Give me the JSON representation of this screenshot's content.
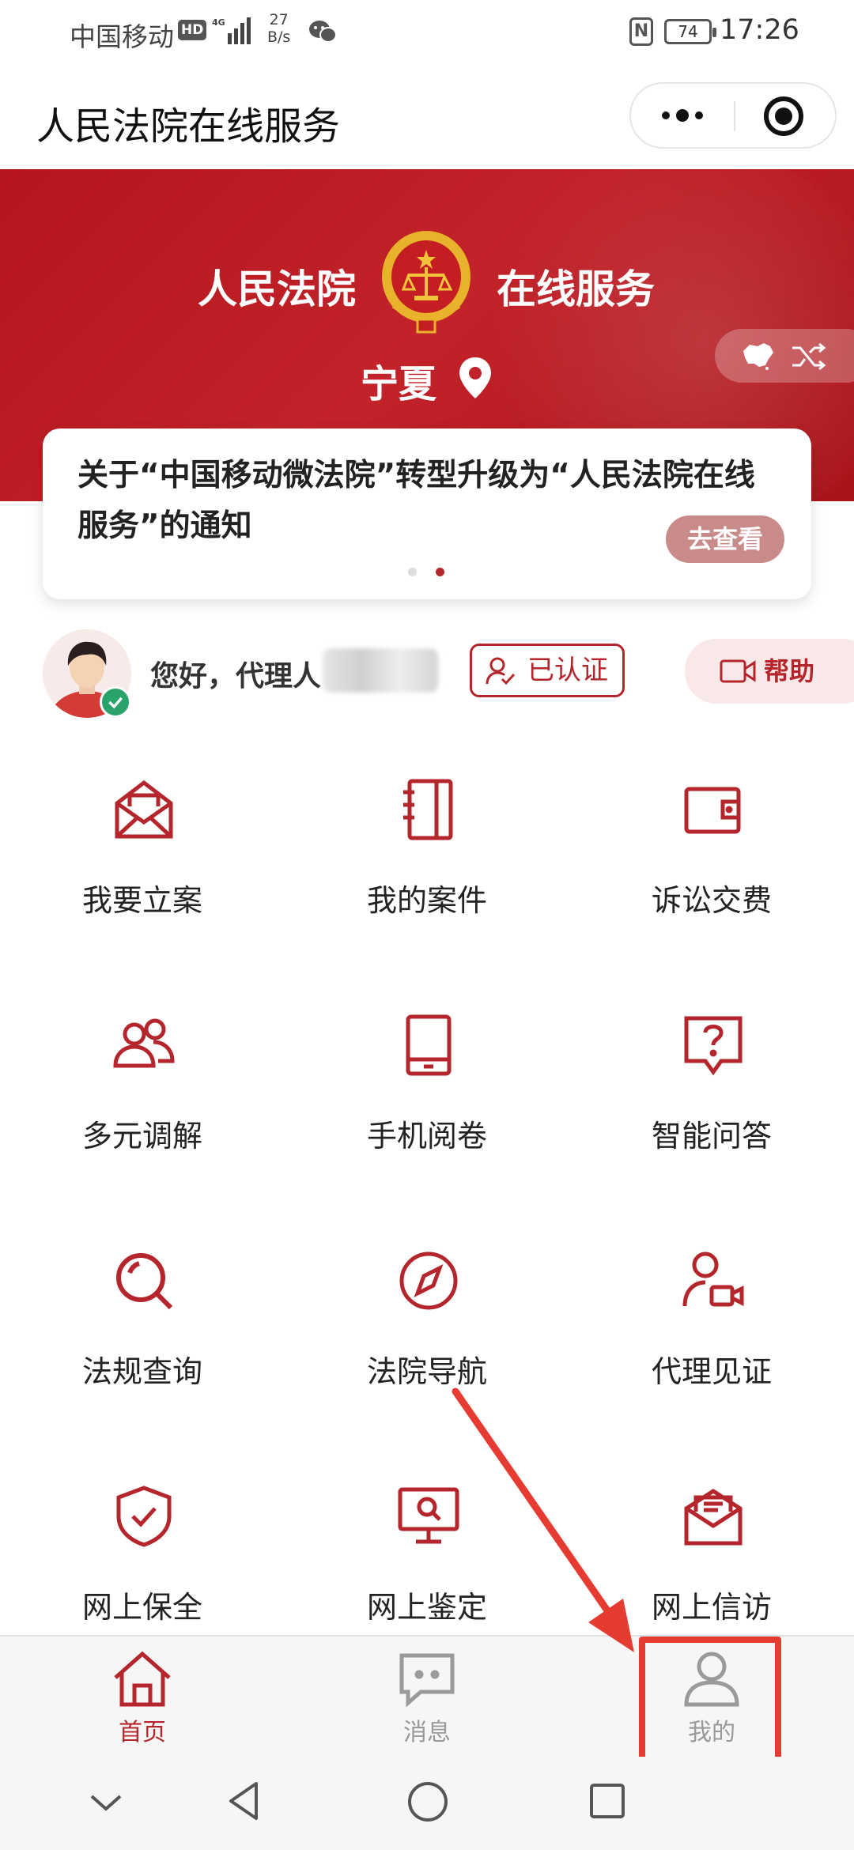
{
  "status_bar": {
    "carrier": "中国移动",
    "hd_badge": "HD",
    "net_speed_value": "27",
    "net_speed_unit": "B/s",
    "nfc": "N",
    "battery": "74",
    "time": "17:26"
  },
  "title_bar": {
    "app_title": "人民法院在线服务"
  },
  "banner": {
    "title_left": "人民法院",
    "title_right": "在线服务",
    "region": "宁夏"
  },
  "notice": {
    "text": "关于“中国移动微法院”转型升级为“人民法院在线服务”的通知",
    "view_button": "去查看",
    "page_count": 2,
    "active_page": 2
  },
  "user": {
    "greeting": "您好，代理人",
    "verified_label": "已认证",
    "help_label": "帮助"
  },
  "services": [
    {
      "label": "我要立案",
      "icon": "envelope-icon"
    },
    {
      "label": "我的案件",
      "icon": "notebook-icon"
    },
    {
      "label": "诉讼交费",
      "icon": "wallet-icon"
    },
    {
      "label": "多元调解",
      "icon": "users-icon"
    },
    {
      "label": "手机阅卷",
      "icon": "tablet-icon"
    },
    {
      "label": "智能问答",
      "icon": "question-chat-icon"
    },
    {
      "label": "法规查询",
      "icon": "search-icon"
    },
    {
      "label": "法院导航",
      "icon": "compass-icon"
    },
    {
      "label": "代理见证",
      "icon": "user-video-icon"
    },
    {
      "label": "网上保全",
      "icon": "shield-check-icon"
    },
    {
      "label": "网上鉴定",
      "icon": "monitor-search-icon"
    },
    {
      "label": "网上信访",
      "icon": "mail-letter-icon"
    }
  ],
  "tab_bar": {
    "tabs": [
      {
        "label": "首页",
        "icon": "home-icon",
        "active": true
      },
      {
        "label": "消息",
        "icon": "message-icon",
        "active": false
      },
      {
        "label": "我的",
        "icon": "person-icon",
        "active": false
      }
    ]
  },
  "colors": {
    "brand_red": "#b5262c",
    "banner_red": "#c22229",
    "inactive_gray": "#999999",
    "annotation_red": "#e53b30"
  }
}
